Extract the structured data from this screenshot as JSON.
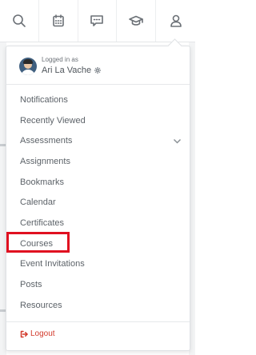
{
  "topbar": {
    "icons": [
      "search-icon",
      "calendar-icon",
      "chat-icon",
      "graduation-cap-icon",
      "user-icon"
    ]
  },
  "account": {
    "logged_in_label": "Logged in as",
    "user_name": "Ari La Vache",
    "settings_icon": "gear-icon"
  },
  "menu": {
    "items": [
      {
        "label": "Notifications"
      },
      {
        "label": "Recently Viewed"
      },
      {
        "label": "Assessments"
      },
      {
        "label": "Assignments"
      },
      {
        "label": "Bookmarks"
      },
      {
        "label": "Calendar"
      },
      {
        "label": "Certificates"
      },
      {
        "label": "Courses"
      },
      {
        "label": "Event Invitations"
      },
      {
        "label": "Posts"
      },
      {
        "label": "Resources"
      }
    ],
    "expandable_item": "Assessments",
    "highlighted_item": "Courses"
  },
  "logout": {
    "label": "Logout",
    "icon": "logout-icon"
  },
  "colors": {
    "highlight": "#e01020",
    "logout": "#d23a2c",
    "text": "#5d6369",
    "icon": "#6b7076"
  }
}
